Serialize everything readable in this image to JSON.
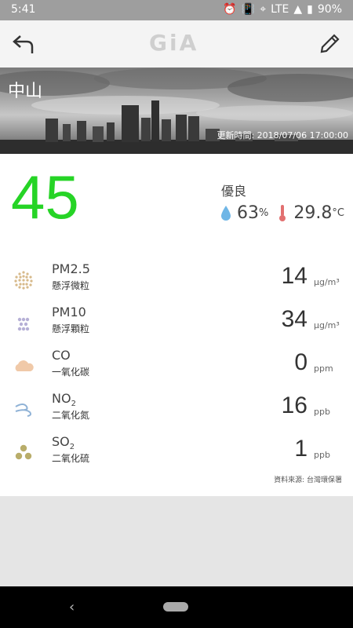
{
  "status": {
    "time": "5:41",
    "network": "LTE",
    "battery": "90%"
  },
  "app": {
    "logo": "GiA"
  },
  "banner": {
    "location": "中山",
    "updated": "更新時間: 2018/07/06 17:00:00"
  },
  "summary": {
    "aqi": "45",
    "quality": "優良",
    "humidity": "63",
    "humidity_unit": "%",
    "temperature": "29.8",
    "temperature_unit": "°C",
    "colors": {
      "aqi": "#26d426",
      "humidity": "#6fb6e6",
      "temperature": "#e27070"
    }
  },
  "pollutants": [
    {
      "name": "PM2.5",
      "subname": "",
      "desc": "懸浮微粒",
      "value": "14",
      "unit": "μg/m³",
      "icon": "pm25-dots-icon"
    },
    {
      "name": "PM10",
      "subname": "",
      "desc": "懸浮顆粒",
      "value": "34",
      "unit": "μg/m³",
      "icon": "pm10-dots-icon"
    },
    {
      "name": "CO",
      "subname": "",
      "desc": "一氧化碳",
      "value": "0",
      "unit": "ppm",
      "icon": "cloud-icon"
    },
    {
      "name": "NO",
      "subname": "2",
      "desc": "二氧化氮",
      "value": "16",
      "unit": "ppb",
      "icon": "wind-swirl-icon"
    },
    {
      "name": "SO",
      "subname": "2",
      "desc": "二氧化硫",
      "value": "1",
      "unit": "ppb",
      "icon": "three-drops-icon"
    }
  ],
  "source": "資料來源: 台灣環保署"
}
